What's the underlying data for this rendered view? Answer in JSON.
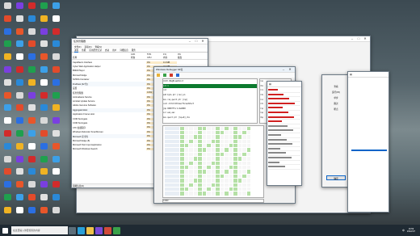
{
  "colors": {
    "desktop_top": "#3c4a52",
    "desktop_bottom": "#2c3236",
    "task_manager_highlight": "#fcebc8",
    "selected_row": "#0c7a2e",
    "hex_green": "#b5e0a6",
    "hex_red_text": "#d02020",
    "taskbar": "#1f2a33",
    "accent_blue": "#0a64c8"
  },
  "desktop_icons": [
    {
      "icon": "recycle-bin-icon",
      "color": "#d9d9d9"
    },
    {
      "icon": "app-icon",
      "color": "#e24b2b"
    },
    {
      "icon": "app-icon",
      "color": "#2b6fe2"
    },
    {
      "icon": "app-icon",
      "color": "#1fa04e"
    },
    {
      "icon": "app-icon",
      "color": "#f0b323"
    },
    {
      "icon": "app-icon",
      "color": "#7a3fe0"
    },
    {
      "icon": "app-icon",
      "color": "#e0e0e0"
    },
    {
      "icon": "app-icon",
      "color": "#e8562a"
    },
    {
      "icon": "app-icon",
      "color": "#3ca0e8"
    },
    {
      "icon": "app-icon",
      "color": "#ffffff"
    },
    {
      "icon": "app-icon",
      "color": "#d22b2b"
    },
    {
      "icon": "app-icon",
      "color": "#2a89d8"
    }
  ],
  "task_manager": {
    "title": "任务管理器",
    "menu": [
      "文件(F)",
      "选项(O)",
      "查看(V)"
    ],
    "tabs": [
      "进程",
      "性能",
      "应用历史记录",
      "启动",
      "用户",
      "详细信息",
      "服务"
    ],
    "columns": [
      "名称",
      "状态",
      "CPU",
      "内存",
      "磁盘",
      "网络"
    ],
    "column_values": [
      "41%",
      "57%",
      "1%",
      "0%"
    ],
    "rows": [
      {
        "name": "CapsRaccs Interface",
        "cpu": "0%",
        "mem": "0.4 MB"
      },
      {
        "name": "Cyber Web Application Helper",
        "cpu": "0%",
        "mem": "2.1 MB"
      },
      {
        "name": "Bilibili Player",
        "cpu": "0%",
        "mem": "18.2 MB"
      },
      {
        "name": "Microsoft Edge",
        "cpu": "0%",
        "mem": "45.3 MB"
      },
      {
        "name": "NVIDIA Container",
        "cpu": "0%",
        "mem": "3.2 MB"
      },
      {
        "name": "FindFast (32 位)",
        "cpu": "0%",
        "mem": "1.0 MB"
      },
      {
        "name": "设置",
        "cpu": "0%",
        "mem": "0 MB"
      },
      {
        "name": "任务管理器",
        "cpu": "0.9%",
        "mem": "22.5 MB"
      },
      {
        "name": "Antimalware Service",
        "cpu": "0%",
        "mem": "120.1 MB"
      },
      {
        "name": "Acrobat Update Service",
        "cpu": "0%",
        "mem": "0.6 MB"
      },
      {
        "name": "Adobe Genuine Software",
        "cpu": "0%",
        "mem": "1.8 MB"
      },
      {
        "name": "AggregatorHost",
        "cpu": "0%",
        "mem": "0.9 MB"
      },
      {
        "name": "Application Frame Host",
        "cpu": "0%",
        "mem": "4.7 MB"
      },
      {
        "name": "COM Surrogate",
        "cpu": "0%",
        "mem": "1.2 MB"
      },
      {
        "name": "COM Surrogate",
        "cpu": "0%",
        "mem": "2.0 MB"
      },
      {
        "name": "CTF 加载程序",
        "cpu": "0%",
        "mem": "6.2 MB"
      },
      {
        "name": "Windows Defender SmartScreen",
        "cpu": "0%",
        "mem": "3.1 MB"
      },
      {
        "name": "Microsoft 安全性",
        "cpu": "0%",
        "mem": "1.5 MB"
      },
      {
        "name": "Microsoft Edge (8)",
        "cpu": "0%",
        "mem": "88.0 MB"
      },
      {
        "name": "Microsoft Text Input Application",
        "cpu": "0%",
        "mem": "7.4 MB"
      },
      {
        "name": "Microsoft Windows Search",
        "cpu": "0%",
        "mem": "12.3 MB"
      }
    ],
    "footer": "简略信息(D)",
    "end_task": "结束任务(E)"
  },
  "debugger": {
    "title": "Windows Debugger 64位",
    "tree_title": "Debugger",
    "asm_lines": [
      "ntdll!DbgBreakPoint",
      "int 3",
      "ret",
      "add byte ptr [rax],al",
      "mov rax,qword ptr [rsp]",
      "call ntdll!RtlUserThreadStart",
      "jmp 00007ffa`1c2e0000",
      "xor eax,eax",
      "mov qword ptr [rsp+8],rbx"
    ],
    "registers": [
      "rax",
      "rbx",
      "rcx",
      "rdx",
      "rsi",
      "rdi",
      "rip",
      "rsp",
      "rbp"
    ],
    "hex_rows": 16,
    "status": "0:000> "
  },
  "side_panel": {
    "labels": [
      "查看",
      "运行(F5)",
      "单步",
      "跳过",
      "断点"
    ],
    "button": "确定"
  },
  "taskbar": {
    "search_placeholder": "在这里输入你要搜索的内容",
    "time": "16:59",
    "date": "2022/4/7",
    "lang": "中"
  }
}
